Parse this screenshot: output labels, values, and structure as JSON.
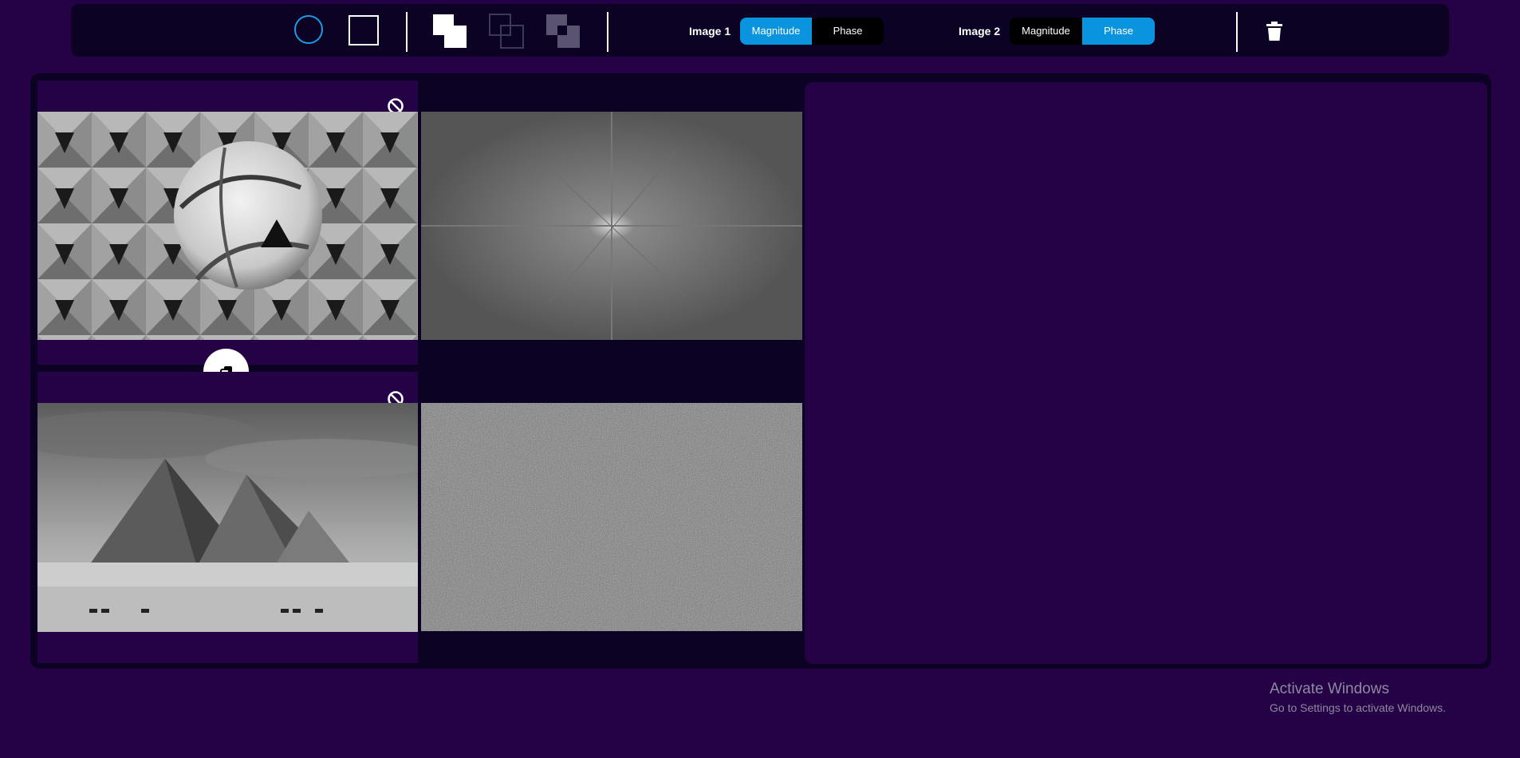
{
  "toolbar": {
    "tools": [
      {
        "name": "circle-region-icon"
      },
      {
        "name": "rectangle-region-icon"
      },
      {
        "name": "inner-region-icon"
      },
      {
        "name": "outer-region-icon"
      },
      {
        "name": "overlap-region-icon"
      }
    ],
    "image1": {
      "label": "Image 1",
      "magnitude": "Magnitude",
      "phase": "Phase",
      "selected": "Magnitude"
    },
    "image2": {
      "label": "Image 2",
      "magnitude": "Magnitude",
      "phase": "Phase",
      "selected": "Phase"
    },
    "delete_icon": "trash-icon"
  },
  "colors": {
    "background": "#250146",
    "panel_dark": "#0b0224",
    "accent": "#0a93de"
  },
  "images": {
    "image1": {
      "subject": "soccer ball on geometric wall (grayscale)",
      "component_view": "magnitude spectrum"
    },
    "image2": {
      "subject": "pyramids of Giza with camels (grayscale)",
      "component_view": "phase spectrum"
    }
  },
  "icons": {
    "block": "block-icon",
    "swap": "swap-images-icon"
  },
  "watermark": {
    "title": "Activate Windows",
    "subtitle": "Go to Settings to activate Windows."
  }
}
